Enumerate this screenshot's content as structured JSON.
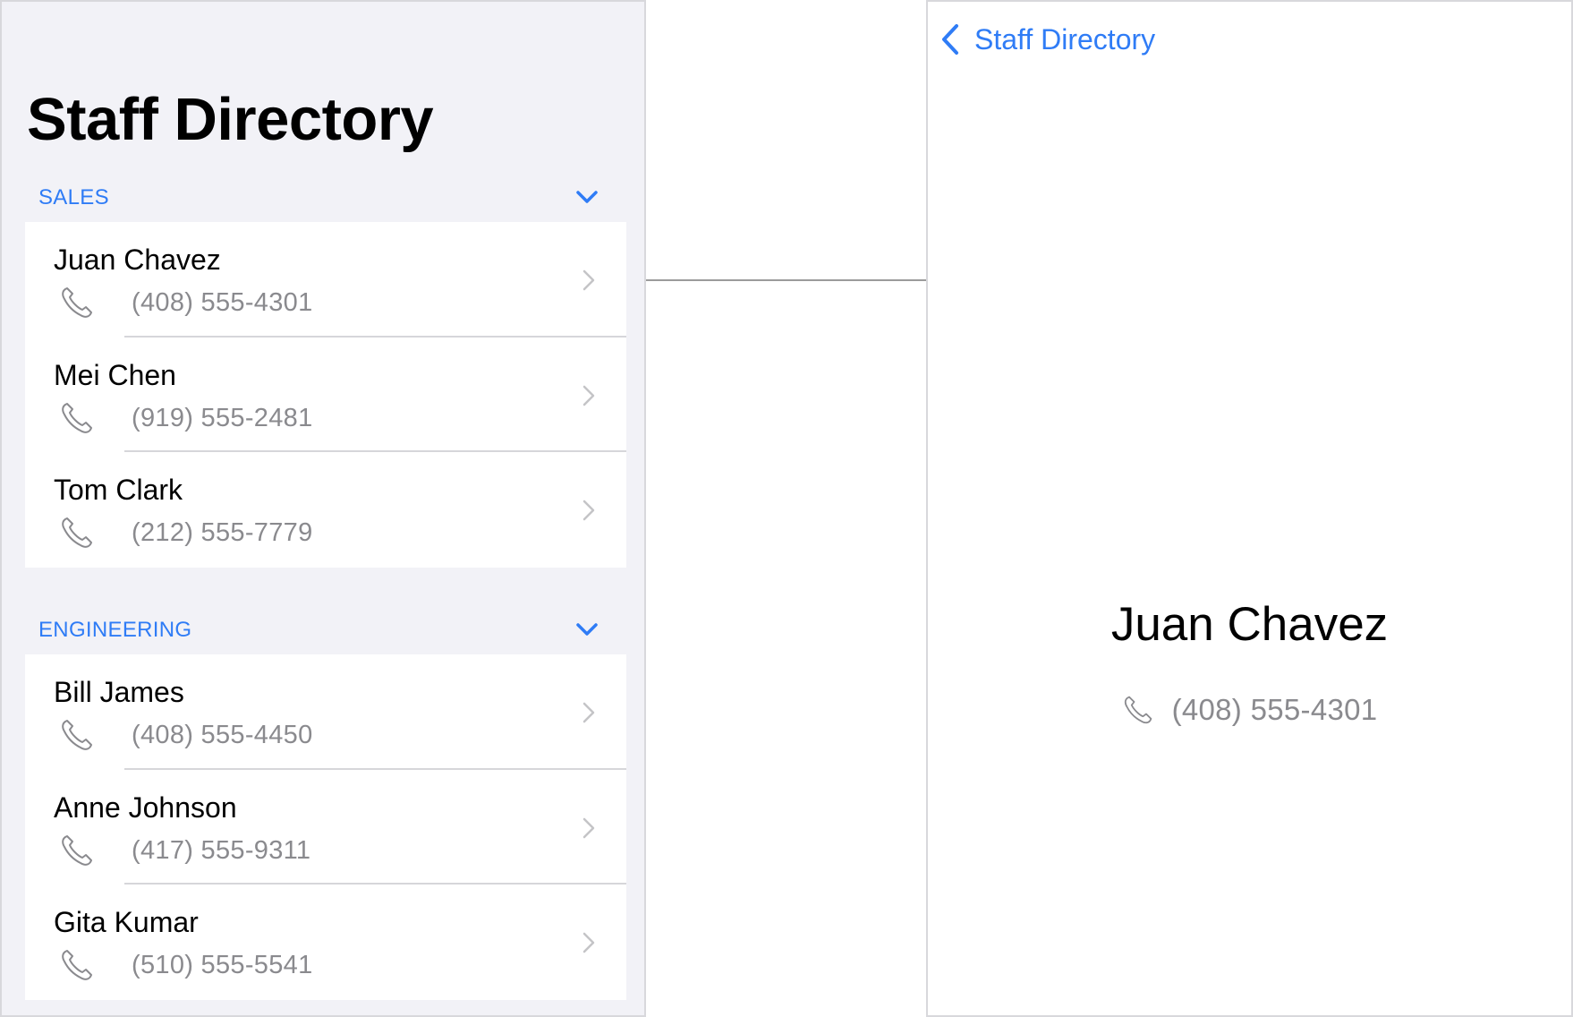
{
  "list_screen": {
    "title": "Staff Directory",
    "sections": [
      {
        "header": "SALES",
        "collapse_icon": "chevron-down-icon",
        "contacts": [
          {
            "name": "Juan Chavez",
            "phone": "(408) 555-4301"
          },
          {
            "name": "Mei Chen",
            "phone": "(919) 555-2481"
          },
          {
            "name": "Tom Clark",
            "phone": "(212) 555-7779"
          }
        ]
      },
      {
        "header": "ENGINEERING",
        "collapse_icon": "chevron-down-icon",
        "contacts": [
          {
            "name": "Bill James",
            "phone": "(408) 555-4450"
          },
          {
            "name": "Anne Johnson",
            "phone": "(417) 555-9311"
          },
          {
            "name": "Gita Kumar",
            "phone": "(510) 555-5541"
          }
        ]
      }
    ]
  },
  "detail_screen": {
    "back_label": "Staff Directory",
    "name": "Juan Chavez",
    "phone": "(408) 555-4301"
  },
  "colors": {
    "accent": "#2f7cf6",
    "secondary_text": "#8a8a8e",
    "grouped_background": "#f2f2f7"
  }
}
